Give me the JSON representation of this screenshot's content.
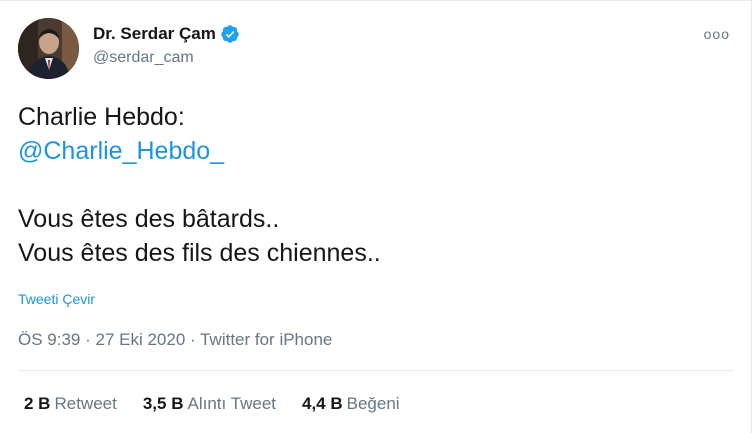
{
  "author": {
    "name": "Dr. Serdar Çam",
    "handle": "@serdar_cam",
    "verified_icon": "verified-badge-icon",
    "avatar_icon": "profile-photo"
  },
  "more_icon": "more-options-icon",
  "more_glyph": "ooo",
  "tweet": {
    "line1": "Charlie Hebdo:",
    "mention": "@Charlie_Hebdo_",
    "line3": "Vous êtes des bâtards..",
    "line4": "Vous êtes des fils des chiennes.."
  },
  "translate_label": "Tweeti Çevir",
  "meta": {
    "time": "ÖS 9:39",
    "sep1": " · ",
    "date": "27 Eki 2020",
    "sep2": " · ",
    "source": "Twitter for iPhone"
  },
  "stats": {
    "retweets": {
      "count": "2 B",
      "label": "Retweet"
    },
    "quotes": {
      "count": "3,5 B",
      "label": "Alıntı Tweet"
    },
    "likes": {
      "count": "4,4 B",
      "label": "Beğeni"
    }
  },
  "colors": {
    "link": "#1b95e0",
    "secondary": "#657786",
    "text": "#14171a",
    "verified": "#1da1f2"
  }
}
